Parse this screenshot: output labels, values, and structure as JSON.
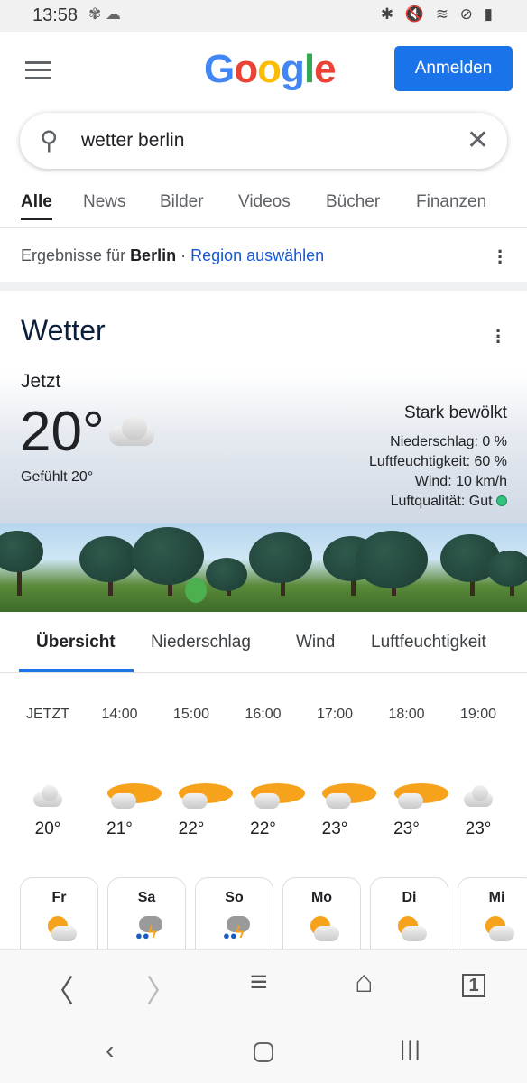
{
  "status": {
    "time": "13:58",
    "left_icons": [
      "network-icon",
      "cloud-icon"
    ],
    "right_icons": [
      "bluetooth-icon",
      "mute-icon",
      "wifi-icon",
      "dnd-icon",
      "battery-icon"
    ]
  },
  "header": {
    "logo": "Google",
    "signin": "Anmelden"
  },
  "search": {
    "query": "wetter berlin"
  },
  "tabs": [
    "Alle",
    "News",
    "Bilder",
    "Videos",
    "Bücher",
    "Finanzen"
  ],
  "region": {
    "prefix": "Ergebnisse für ",
    "place": "Berlin",
    "sep": " · ",
    "link": "Region auswählen"
  },
  "weather": {
    "title": "Wetter",
    "now_label": "Jetzt",
    "temp": "20°",
    "felt": "Gefühlt 20°",
    "condition": "Stark bewölkt",
    "precip": "Niederschlag: 0 %",
    "humidity": "Luftfeuchtigkeit: 60 %",
    "wind": "Wind: 10 km/h",
    "air": "Luftqualität: Gut",
    "air_color": "#34c27d",
    "tabs": [
      "Übersicht",
      "Niederschlag",
      "Wind",
      "Luftfeuchtigkeit"
    ],
    "hours": [
      {
        "t": "JETZT",
        "v": "20°",
        "icon": "cloud"
      },
      {
        "t": "14:00",
        "v": "21°",
        "icon": "partly-sunny"
      },
      {
        "t": "15:00",
        "v": "22°",
        "icon": "partly-sunny"
      },
      {
        "t": "16:00",
        "v": "22°",
        "icon": "partly-sunny"
      },
      {
        "t": "17:00",
        "v": "23°",
        "icon": "partly-sunny"
      },
      {
        "t": "18:00",
        "v": "23°",
        "icon": "partly-sunny"
      },
      {
        "t": "19:00",
        "v": "23°",
        "icon": "cloud"
      }
    ],
    "days": [
      {
        "d": "Fr",
        "icon": "partly-sunny"
      },
      {
        "d": "Sa",
        "icon": "thunderstorm"
      },
      {
        "d": "So",
        "icon": "thunderstorm"
      },
      {
        "d": "Mo",
        "icon": "partly-sunny"
      },
      {
        "d": "Di",
        "icon": "partly-sunny"
      },
      {
        "d": "Mi",
        "icon": "partly-sunny"
      }
    ]
  },
  "browser_bar": {
    "tab_count": "1"
  },
  "colors": {
    "accent": "#1a73e8"
  }
}
